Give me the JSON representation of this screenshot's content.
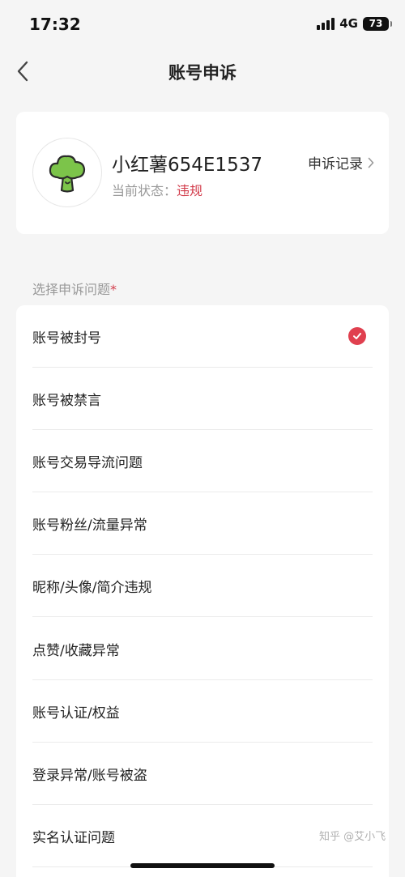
{
  "status_bar": {
    "time": "17:32",
    "network": "4G",
    "battery": "73"
  },
  "nav": {
    "title": "账号申诉",
    "back_icon": "chevron-left-icon"
  },
  "profile": {
    "avatar_icon": "broccoli-icon",
    "username": "小红薯654E1537",
    "status_label": "当前状态：",
    "status_value": "违规",
    "record_label": "申诉记录",
    "record_icon": "chevron-right-icon"
  },
  "section": {
    "title": "选择申诉问题",
    "required_mark": "*"
  },
  "options": [
    {
      "label": "账号被封号",
      "selected": true
    },
    {
      "label": "账号被禁言",
      "selected": false
    },
    {
      "label": "账号交易导流问题",
      "selected": false
    },
    {
      "label": "账号粉丝/流量异常",
      "selected": false
    },
    {
      "label": "昵称/头像/简介违规",
      "selected": false
    },
    {
      "label": "点赞/收藏异常",
      "selected": false
    },
    {
      "label": "账号认证/权益",
      "selected": false
    },
    {
      "label": "登录异常/账号被盗",
      "selected": false
    },
    {
      "label": "实名认证问题",
      "selected": false
    }
  ],
  "watermark": "知乎 @艾小飞",
  "colors": {
    "accent": "#e0404f",
    "avatar_green": "#7cc44a"
  }
}
